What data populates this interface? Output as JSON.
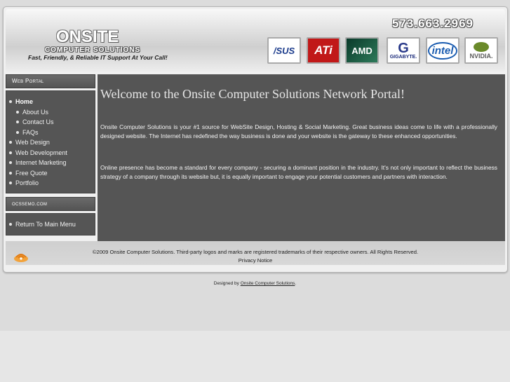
{
  "header": {
    "logo_title": "ONSITE",
    "logo_subtitle": "COMPUTER SOLUTIONS",
    "tagline": "Fast, Friendly, & Reliable IT Support At Your Call!",
    "phone": "573.663.2969",
    "brands": [
      {
        "name": "asus-logo",
        "label": "/SUS"
      },
      {
        "name": "ati-logo",
        "label": "ATi"
      },
      {
        "name": "amd-logo",
        "label": "AMD"
      },
      {
        "name": "gigabyte-logo",
        "label": "GIGABYTE."
      },
      {
        "name": "intel-logo",
        "label": "intel"
      },
      {
        "name": "nvidia-logo",
        "label": "NVIDIA."
      }
    ]
  },
  "sidebar": {
    "portal_heading": "Web Portal",
    "items": [
      {
        "label": "Home",
        "active": true
      },
      {
        "label": "About Us",
        "sub": true
      },
      {
        "label": "Contact Us",
        "sub": true
      },
      {
        "label": "FAQs",
        "sub": true
      },
      {
        "label": "Web Design"
      },
      {
        "label": "Web Development"
      },
      {
        "label": "Internet Marketing"
      },
      {
        "label": "Free Quote"
      },
      {
        "label": "Portfolio"
      }
    ],
    "site_heading": "ocssemo.com",
    "return_label": "Return To Main Menu"
  },
  "main": {
    "heading": "Welcome to the Onsite Computer Solutions Network Portal!",
    "para1": "Onsite Computer Solutions is your #1 source for WebSite Design, Hosting & Social Marketing. Great business ideas come to life with a professionally designed website. The Internet has redefined the way business is done and your website is the gateway to these enhanced opportunities.",
    "para2": "Online presence has become a standard for every company - securing a dominant position in the industry. It's not only important to reflect the business strategy of a company through its website but, it is equally important to engage your potential customers and partners with interaction."
  },
  "footer": {
    "copyright": "©2009 Onsite Computer Solutions. Third-party logos and marks are registered trademarks of their respective owners. All Rights Reserved.",
    "privacy": "Privacy Notice",
    "designed_by": "Designed by",
    "designer_link": "Onsite Computer Solutions",
    "designer_suffix": "."
  },
  "colors": {
    "content_bg": "#555555",
    "page_bg": "#dcdcdc",
    "accent_text": "#e6e6e6"
  }
}
